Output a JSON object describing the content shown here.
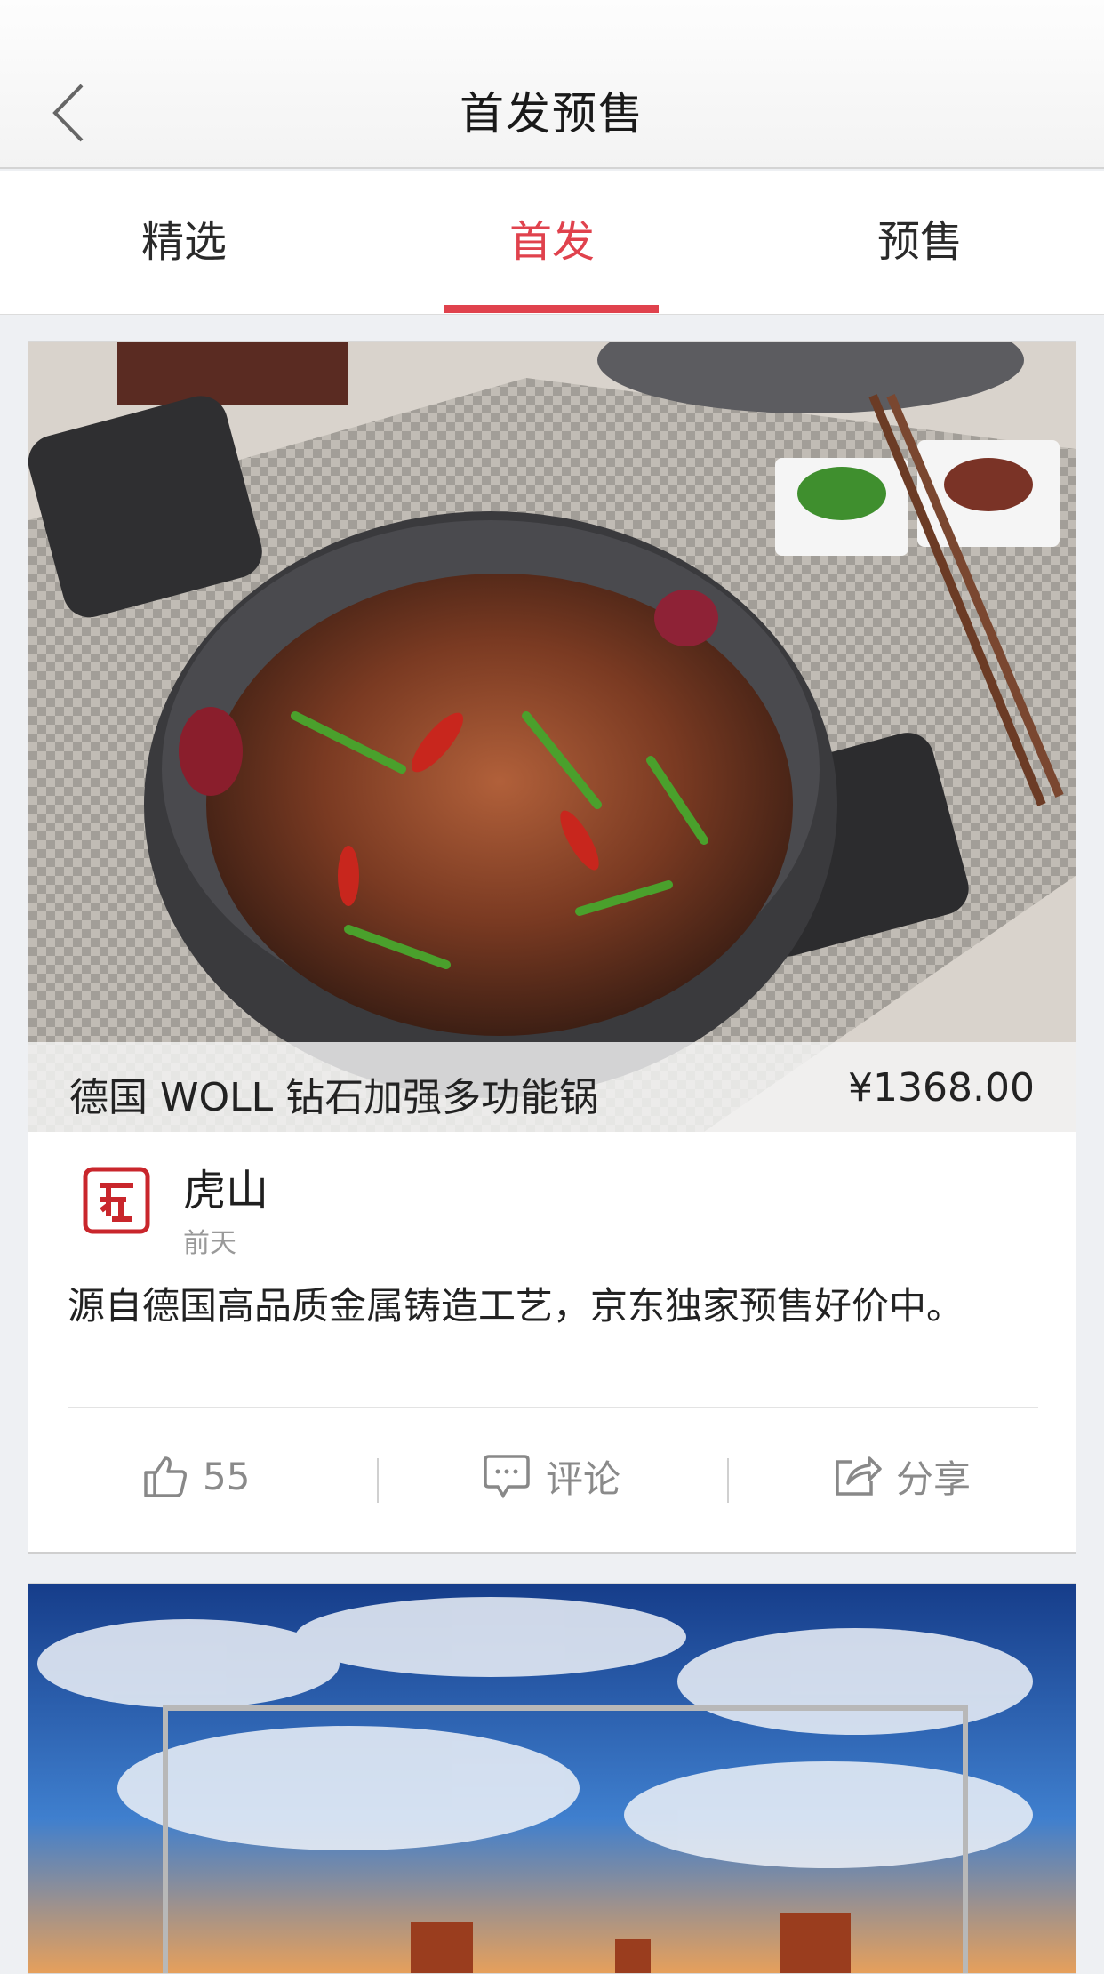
{
  "header": {
    "title": "首发预售",
    "back_icon": "chevron-left-icon"
  },
  "tabs": [
    {
      "label": "精选",
      "active": false
    },
    {
      "label": "首发",
      "active": true
    },
    {
      "label": "预售",
      "active": false
    }
  ],
  "accent_color": "#e0424d",
  "feed": [
    {
      "product_name": "德国 WOLL 钻石加强多功能锅",
      "price": "¥1368.00",
      "author": "虎山",
      "time": "前天",
      "description": "源自德国高品质金属铸造工艺，京东独家预售好价中。",
      "actions": {
        "like_count": "55",
        "comment_label": "评论",
        "share_label": "分享"
      }
    }
  ]
}
